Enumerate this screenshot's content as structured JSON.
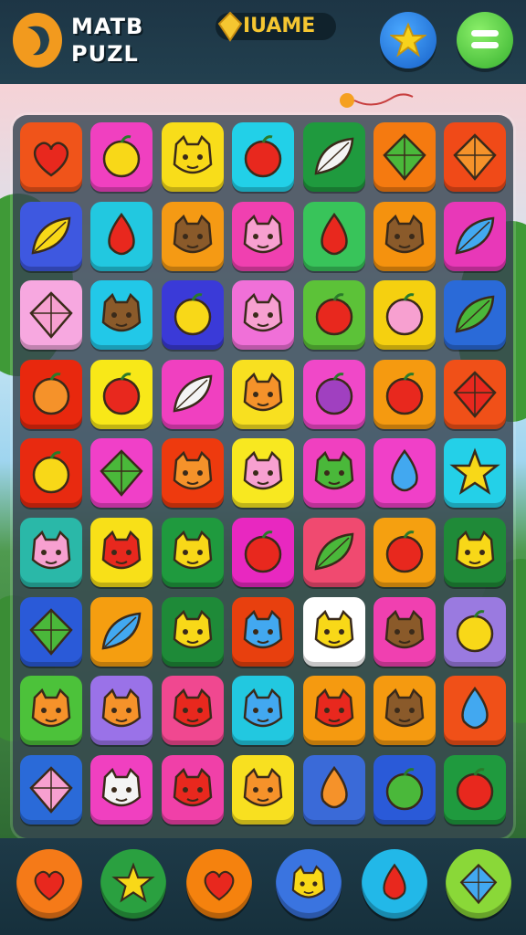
{
  "header": {
    "title_line1": "MATB",
    "title_line2": "PUZL",
    "coin_label": "IUAME",
    "colors": {
      "coin": "#f5c631",
      "logo": "#f29a1e"
    }
  },
  "buttons": {
    "favorites_icon": "star-icon",
    "menu_icon": "hamburger-menu-icon"
  },
  "grid": {
    "rows": 9,
    "cols": 7,
    "tiles": [
      [
        "red-heart",
        "yellow-lemon",
        "yellow-cat",
        "red-berry",
        "white-leaf",
        "green-kite",
        "orange-kite"
      ],
      [
        "yellow-paper-plane",
        "red-drop",
        "brown-bear",
        "pink-face",
        "red-carrot",
        "brown-cat",
        "blue-leaf"
      ],
      [
        "pink-gem",
        "brown-owl",
        "yellow-lemon",
        "pink-face",
        "red-strawberry",
        "pink-eggplant",
        "green-leaf"
      ],
      [
        "orange-sun",
        "red-rose",
        "white-paper-plane",
        "orange-cat",
        "purple-grape",
        "red-cake",
        "red-gem"
      ],
      [
        "yellow-pear",
        "green-kite",
        "orange-chick",
        "pink-cat",
        "green-face",
        "blue-balloon",
        "yellow-star"
      ],
      [
        "pink-fox",
        "red-cat",
        "yellow-chick",
        "red-apple",
        "green-leaf",
        "red-apple",
        "yellow-chick"
      ],
      [
        "green-gem",
        "blue-triangle",
        "yellow-chick",
        "blue-face",
        "yellow-chick",
        "brown-cat",
        "yellow-flower"
      ],
      [
        "orange-cat",
        "orange-chick",
        "red-fox",
        "blue-wolf",
        "red-cat",
        "brown-bear",
        "blue-cone"
      ],
      [
        "pink-kite",
        "white-cat",
        "red-fox",
        "orange-chick",
        "orange-carrot",
        "green-apple",
        "red-strawberry"
      ]
    ],
    "tile_colors": [
      [
        "#f0541a",
        "#f040c0",
        "#f8dd1a",
        "#22d0e8",
        "#1f9a3e",
        "#f57a10",
        "#f04a18"
      ],
      [
        "#3e58e0",
        "#22c8e0",
        "#f59a14",
        "#f040b0",
        "#38c45a",
        "#f5920e",
        "#e838b8"
      ],
      [
        "#f7a8e0",
        "#22c8e8",
        "#3a3ad8",
        "#f070d8",
        "#5cc238",
        "#f5d010",
        "#2a6ad8"
      ],
      [
        "#e8280e",
        "#f8e818",
        "#f040c0",
        "#f8e020",
        "#f048c8",
        "#f59a10",
        "#f05018"
      ],
      [
        "#e82a10",
        "#f040c8",
        "#ee3a0e",
        "#f8e820",
        "#f040c0",
        "#f040c8",
        "#24d0e8"
      ],
      [
        "#2ab8a8",
        "#f8e018",
        "#1f9a3e",
        "#e828c0",
        "#f04a70",
        "#f5a010",
        "#1f8a38"
      ],
      [
        "#2a5ad8",
        "#f59e10",
        "#1e8a38",
        "#e8400e",
        "#ffffff",
        "#f040b0",
        "#9a7ae0"
      ],
      [
        "#4cc23a",
        "#9a72e8",
        "#f04890",
        "#22c8e0",
        "#f59a10",
        "#f59a10",
        "#f05018"
      ],
      [
        "#2a6ad8",
        "#f040c0",
        "#f040a8",
        "#f8e020",
        "#3a6ad8",
        "#2a5ad8",
        "#1f9a3e"
      ]
    ]
  },
  "powerups": [
    {
      "icon": "heart-icon",
      "color": "#f57a18"
    },
    {
      "icon": "star-burst-icon",
      "color": "#2aa040"
    },
    {
      "icon": "heart-icon",
      "color": "#f5820e"
    },
    {
      "icon": "cat-face-icon",
      "color": "#3a74e0"
    },
    {
      "icon": "cone-icon",
      "color": "#22b8e8"
    },
    {
      "icon": "kite-icon",
      "color": "#8ad838"
    }
  ]
}
